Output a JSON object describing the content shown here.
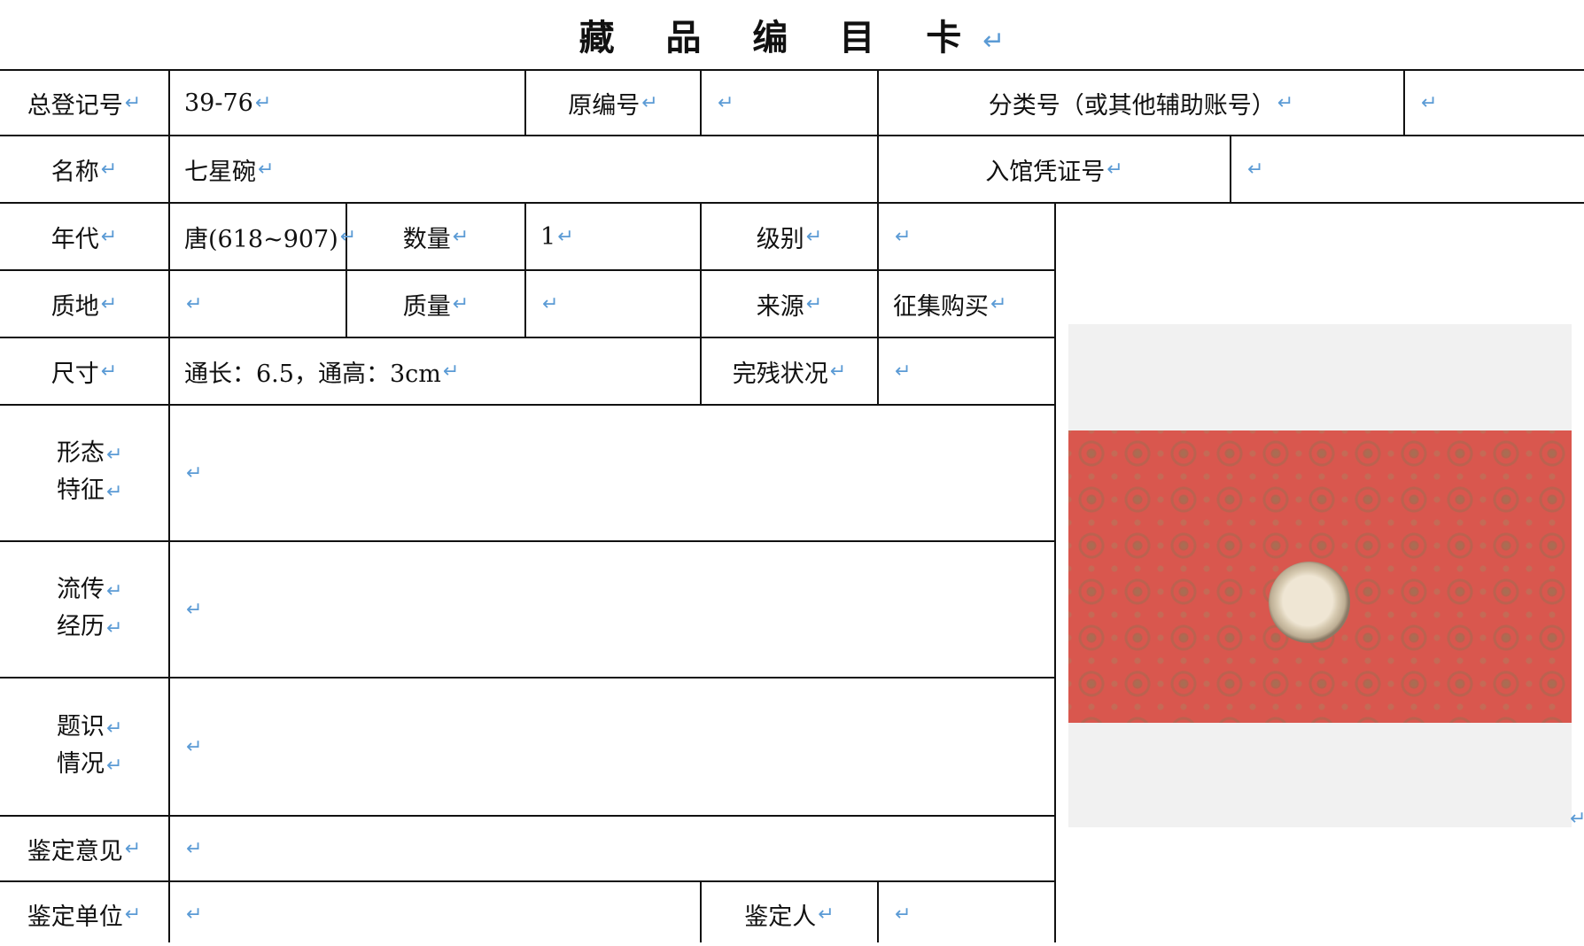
{
  "title": "藏 品 编 目 卡",
  "mark": "↵",
  "labels": {
    "reg_no": "总登记号",
    "orig_no": "原编号",
    "class_no": "分类号（或其他辅助账号）",
    "name": "名称",
    "entry_no": "入馆凭证号",
    "era": "年代",
    "quantity": "数量",
    "grade": "级别",
    "material": "质地",
    "weight": "质量",
    "source": "来源",
    "size": "尺寸",
    "condition": "完残状况",
    "form_1": "形态",
    "form_2": "特征",
    "history_1": "流传",
    "history_2": "经历",
    "inscription_1": "题识",
    "inscription_2": "情况",
    "appraisal": "鉴定意见",
    "appraisal_unit": "鉴定单位",
    "appraiser": "鉴定人"
  },
  "values": {
    "reg_no": "39-76",
    "orig_no": "",
    "class_no": "",
    "name": "七星碗",
    "entry_no": "",
    "era": "唐(618~907)",
    "quantity": "1",
    "grade": "",
    "material": "",
    "weight": "",
    "source": "征集购买",
    "size": "通长：6.5，通高：3cm",
    "condition": "",
    "form": "",
    "history": "",
    "inscription": "",
    "appraisal": "",
    "appraisal_unit": "",
    "appraiser": ""
  },
  "colors": {
    "paragraph_mark": "#5b9bd5",
    "photo_background": "#d9574e"
  }
}
